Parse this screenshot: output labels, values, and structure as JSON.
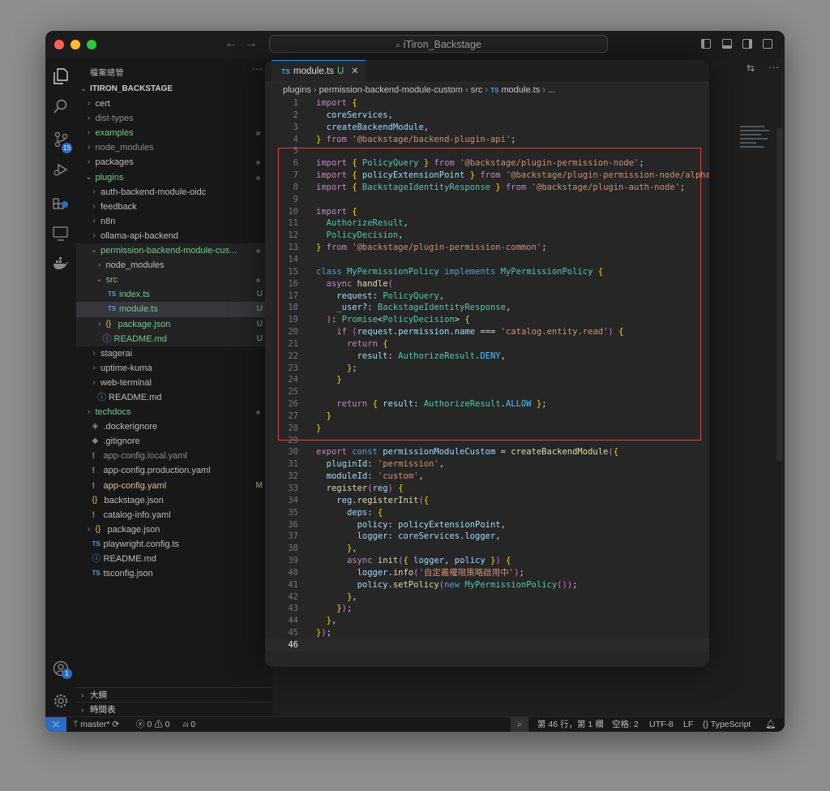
{
  "window": {
    "title": "iTiron_Backstage"
  },
  "activity_bar": {
    "scm_badge": "15",
    "account_badge": "1"
  },
  "sidebar": {
    "header": "檔案總管",
    "root": "ITIRON_BACKSTAGE",
    "items": [
      {
        "label": "cert",
        "color": "#bbbbbb"
      },
      {
        "label": "dist-types",
        "color": "#8c8c8c"
      },
      {
        "label": "examples",
        "color": "#73c991"
      },
      {
        "label": "node_modules",
        "color": "#8c8c8c"
      },
      {
        "label": "packages",
        "color": "#bbbbbb"
      },
      {
        "label": "plugins",
        "color": "#73c991"
      },
      {
        "label": "auth-backend-module-oidc",
        "color": "#bbbbbb"
      },
      {
        "label": "feedback",
        "color": "#bbbbbb"
      },
      {
        "label": "n8n",
        "color": "#bbbbbb"
      },
      {
        "label": "ollama-api-backend",
        "color": "#bbbbbb"
      },
      {
        "label": "permission-backend-module-cus...",
        "color": "#73c991"
      },
      {
        "label": "node_modules",
        "color": "#bbbbbb"
      },
      {
        "label": "src",
        "color": "#73c991"
      },
      {
        "label": "index.ts",
        "color": "#73c991",
        "status": "U"
      },
      {
        "label": "module.ts",
        "color": "#73c991",
        "status": "U"
      },
      {
        "label": "package.json",
        "color": "#73c991",
        "status": "U"
      },
      {
        "label": "README.md",
        "color": "#73c991",
        "status": "U"
      },
      {
        "label": "stagerai",
        "color": "#bbbbbb"
      },
      {
        "label": "uptime-kuma",
        "color": "#bbbbbb"
      },
      {
        "label": "web-terminal",
        "color": "#bbbbbb"
      },
      {
        "label": "README.md",
        "color": "#bbbbbb"
      },
      {
        "label": "techdocs",
        "color": "#73c991"
      },
      {
        "label": ".dockerignore",
        "color": "#bbbbbb"
      },
      {
        "label": ".gitignore",
        "color": "#bbbbbb"
      },
      {
        "label": "app-config.local.yaml",
        "color": "#8c8c8c"
      },
      {
        "label": "app-config.production.yaml",
        "color": "#bbbbbb"
      },
      {
        "label": "app-config.yaml",
        "color": "#e2c08d",
        "status": "M"
      },
      {
        "label": "backstage.json",
        "color": "#bbbbbb"
      },
      {
        "label": "catalog-info.yaml",
        "color": "#bbbbbb"
      },
      {
        "label": "package.json",
        "color": "#bbbbbb"
      },
      {
        "label": "playwright.config.ts",
        "color": "#bbbbbb"
      },
      {
        "label": "README.md",
        "color": "#bbbbbb"
      },
      {
        "label": "tsconfig.json",
        "color": "#bbbbbb"
      }
    ],
    "outline": "大綱",
    "timeline": "時間表"
  },
  "editor": {
    "tab": {
      "icon": "TS",
      "label": "module.ts",
      "status": "U"
    },
    "breadcrumb": [
      "plugins",
      "permission-backend-module-custom",
      "src",
      "TS",
      "module.ts",
      "..."
    ],
    "lines": [
      "import {",
      "  coreServices,",
      "  createBackendModule,",
      "} from '@backstage/backend-plugin-api';",
      "",
      "import { PolicyQuery } from '@backstage/plugin-permission-node';",
      "import { policyExtensionPoint } from '@backstage/plugin-permission-node/alpha';",
      "import { BackstageIdentityResponse } from '@backstage/plugin-auth-node';",
      "",
      "import {",
      "  AuthorizeResult,",
      "  PolicyDecision,",
      "} from '@backstage/plugin-permission-common';",
      "",
      "class MyPermissionPolicy implements MyPermissionPolicy {",
      "  async handle(",
      "    request: PolicyQuery,",
      "    _user?: BackstageIdentityResponse,",
      "  ): Promise<PolicyDecision> {",
      "    if (request.permission.name === 'catalog.entity.read') {",
      "      return {",
      "        result: AuthorizeResult.DENY,",
      "      };",
      "    }",
      "",
      "    return { result: AuthorizeResult.ALLOW };",
      "  }",
      "}",
      "",
      "export const permissionModuleCustom = createBackendModule({",
      "  pluginId: 'permission',",
      "  moduleId: 'custom',",
      "  register(reg) {",
      "    reg.registerInit({",
      "      deps: {",
      "        policy: policyExtensionPoint,",
      "        logger: coreServices.logger,",
      "      },",
      "      async init({ logger, policy }) {",
      "        logger.info('自定義權限策略啟用中');",
      "        policy.setPolicy(new MyPermissionPolicy());",
      "      },",
      "    });",
      "  },",
      "});",
      ""
    ]
  },
  "status_bar": {
    "branch": "master*",
    "errors": "0",
    "warnings": "0",
    "ports": "0",
    "position": "第 46 行，第 1 欄",
    "spaces": "空格: 2",
    "encoding": "UTF-8",
    "eol": "LF",
    "language": "TypeScript"
  },
  "colors": {
    "accent": "#2b6cc4",
    "highlight_box": "#d9453f",
    "git_untracked": "#73c991",
    "git_modified": "#e2c08d"
  }
}
